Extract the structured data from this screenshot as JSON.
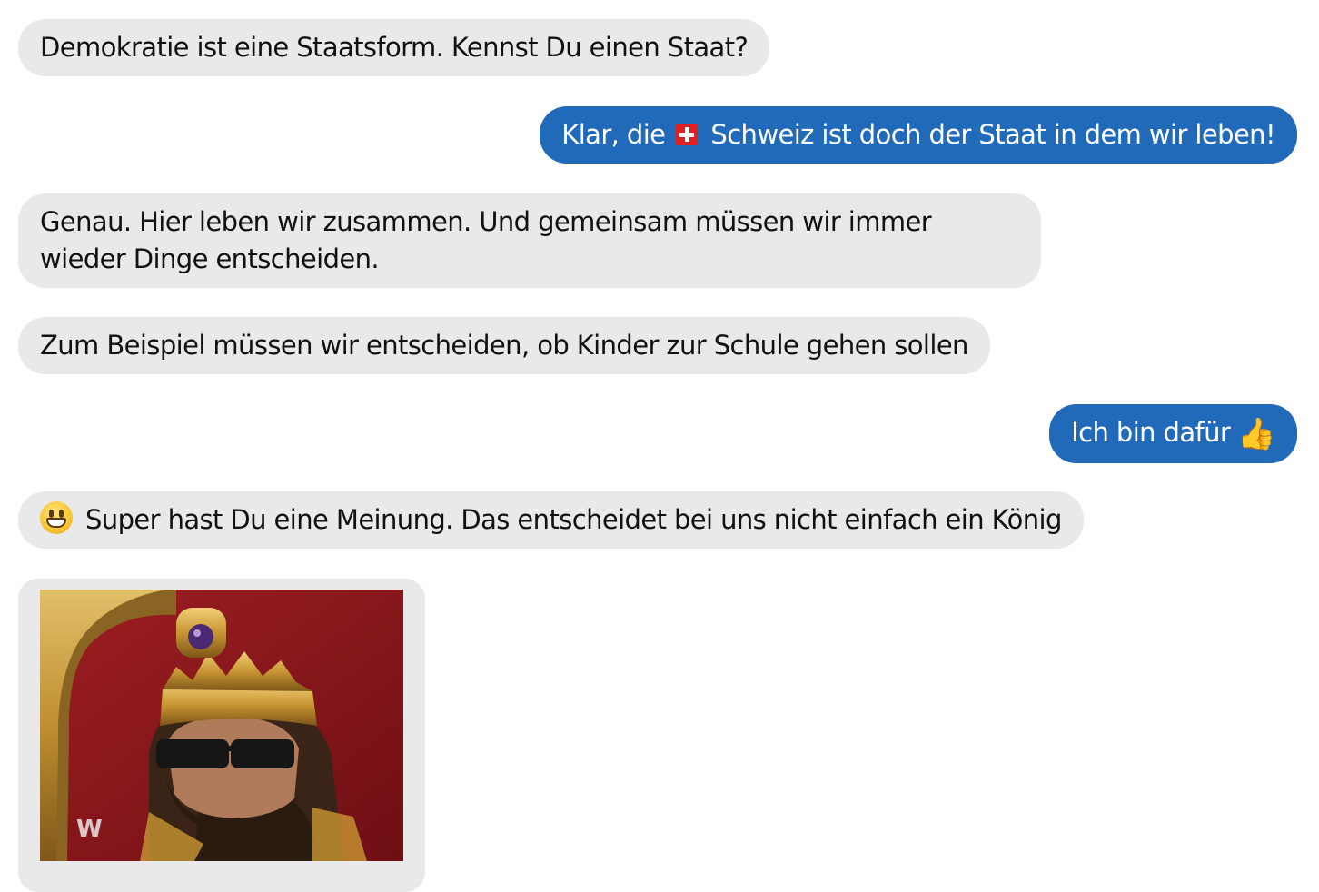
{
  "messages": [
    {
      "sender": "bot",
      "text": "Demokratie ist eine Staatsform. Kennst Du einen Staat?"
    },
    {
      "sender": "user",
      "text_before": "Klar, die",
      "icon": "swiss-flag-icon",
      "text_after": "Schweiz ist doch der Staat in dem wir leben!"
    },
    {
      "sender": "bot",
      "text": "Genau. Hier leben wir zusammen. Und gemeinsam müssen wir immer wieder Dinge entscheiden."
    },
    {
      "sender": "bot",
      "text": "Zum Beispiel müssen wir entscheiden, ob Kinder zur Schule gehen sollen"
    },
    {
      "sender": "user",
      "text": "Ich bin dafür",
      "icon": "thumbs-up-icon",
      "emoji": "👍"
    },
    {
      "sender": "bot",
      "icon": "grinning-face-icon",
      "text": "Super hast Du eine Meinung. Das entscheidet bei uns nicht einfach ein König"
    },
    {
      "sender": "bot",
      "type": "image",
      "image": "wrestler-king-crown-gif",
      "watermark": "W"
    }
  ],
  "colors": {
    "bot_bubble": "#e9e9eb",
    "user_bubble": "#2169b9",
    "bot_text": "#111111",
    "user_text": "#ffffff"
  }
}
